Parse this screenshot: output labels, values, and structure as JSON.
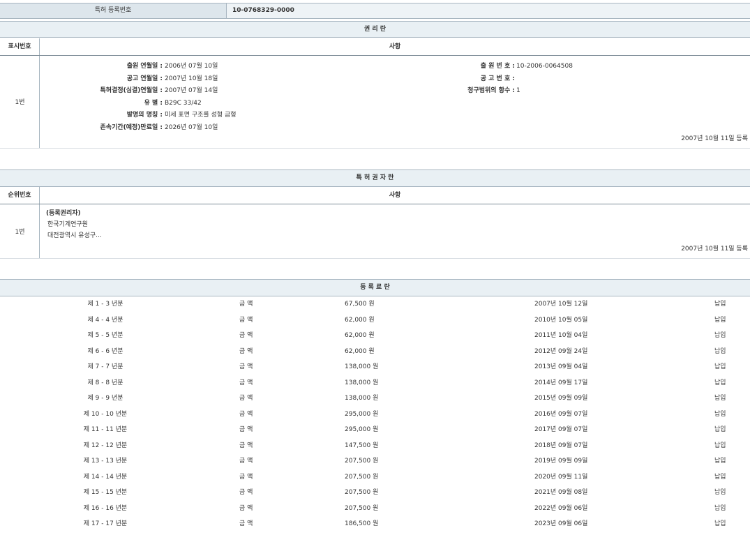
{
  "reg": {
    "label": "특허 등록번호",
    "value": "10-0768329-0000"
  },
  "rights": {
    "title": "권 리 란",
    "col1": "표시번호",
    "col2": "사항",
    "rows": [
      {
        "no": "1번",
        "left": [
          {
            "label": "출원 연월일 :",
            "value": "2006년 07월 10일"
          },
          {
            "label": "공고 연월일 :",
            "value": "2007년 10월 18일"
          },
          {
            "label": "특허결정(심결)연월일 :",
            "value": "2007년 07월 14일"
          },
          {
            "label": "유 별 :",
            "value": "B29C 33/42"
          },
          {
            "label": "발명의 명칭 :",
            "value": "미세 표면 구조를 성형 금형"
          },
          {
            "label": "존속기간(예정)만료일 :",
            "value": "2026년 07월 10일"
          }
        ],
        "right": [
          {
            "label": "출 원 번 호 :",
            "value": "10-2006-0064508"
          },
          {
            "label": "공 고 번 호 :",
            "value": ""
          },
          {
            "label": "청구범위의 항수 :",
            "value": "1"
          }
        ],
        "stamp": "2007년 10월 11일 등록"
      }
    ]
  },
  "holders": {
    "title": "특 허 권 자 란",
    "col1": "순위번호",
    "col2": "사항",
    "rows": [
      {
        "no": "1번",
        "role": "(등록권리자)",
        "name": "한국기계연구원",
        "address": "대전광역시 유성구...",
        "stamp": "2007년 10월 11일 등록"
      }
    ]
  },
  "fees": {
    "title": "등 록 료 란",
    "amount_label": "금 액",
    "rows": [
      {
        "period": "제 1 - 3 년분",
        "amount": "67,500 원",
        "date": "2007년 10월 12일",
        "status": "납입"
      },
      {
        "period": "제 4 - 4 년분",
        "amount": "62,000 원",
        "date": "2010년 10월 05일",
        "status": "납입"
      },
      {
        "period": "제 5 - 5 년분",
        "amount": "62,000 원",
        "date": "2011년 10월 04일",
        "status": "납입"
      },
      {
        "period": "제 6 - 6 년분",
        "amount": "62,000 원",
        "date": "2012년 09월 24일",
        "status": "납입"
      },
      {
        "period": "제 7 - 7 년분",
        "amount": "138,000 원",
        "date": "2013년 09월 04일",
        "status": "납입"
      },
      {
        "period": "제 8 - 8 년분",
        "amount": "138,000 원",
        "date": "2014년 09월 17일",
        "status": "납입"
      },
      {
        "period": "제 9 - 9 년분",
        "amount": "138,000 원",
        "date": "2015년 09월 09일",
        "status": "납입"
      },
      {
        "period": "제 10 - 10 년분",
        "amount": "295,000 원",
        "date": "2016년 09월 07일",
        "status": "납입"
      },
      {
        "period": "제 11 - 11 년분",
        "amount": "295,000 원",
        "date": "2017년 09월 07일",
        "status": "납입"
      },
      {
        "period": "제 12 - 12 년분",
        "amount": "147,500 원",
        "date": "2018년 09월 07일",
        "status": "납입"
      },
      {
        "period": "제 13 - 13 년분",
        "amount": "207,500 원",
        "date": "2019년 09월 09일",
        "status": "납입"
      },
      {
        "period": "제 14 - 14 년분",
        "amount": "207,500 원",
        "date": "2020년 09월 11일",
        "status": "납입"
      },
      {
        "period": "제 15 - 15 년분",
        "amount": "207,500 원",
        "date": "2021년 09월 08일",
        "status": "납입"
      },
      {
        "period": "제 16 - 16 년분",
        "amount": "207,500 원",
        "date": "2022년 09월 06일",
        "status": "납입"
      },
      {
        "period": "제 17 - 17 년분",
        "amount": "186,500 원",
        "date": "2023년 09월 06일",
        "status": "납입"
      }
    ]
  }
}
